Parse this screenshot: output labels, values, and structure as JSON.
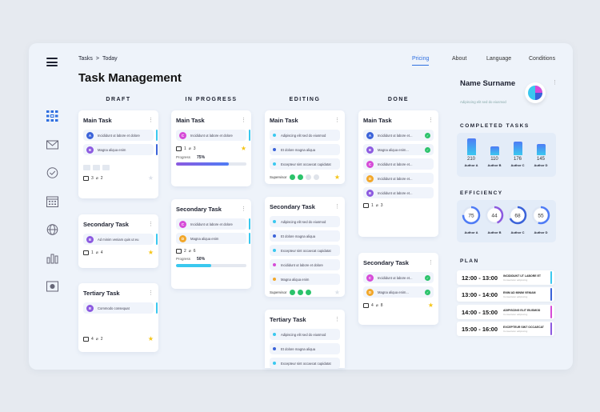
{
  "breadcrumb": {
    "root": "Tasks",
    "sep": ">",
    "current": "Today"
  },
  "title": "Task Management",
  "nav": [
    {
      "label": "Pricing",
      "active": true
    },
    {
      "label": "About"
    },
    {
      "label": "Language"
    },
    {
      "label": "Conditions"
    }
  ],
  "columns": {
    "draft": "DRAFT",
    "progress": "IN PROGRESS",
    "editing": "EDITING",
    "done": "DONE"
  },
  "cards": {
    "d1": {
      "title": "Main Task",
      "items": [
        "Incididunt ut labore et dolore",
        "Magna aliqua enim"
      ],
      "comments": "3",
      "attach": "2"
    },
    "d2": {
      "title": "Secondary Task",
      "items": [
        "Ad minim veniam quis ut eu"
      ],
      "comments": "1",
      "attach": "4"
    },
    "d3": {
      "title": "Tertiary Task",
      "items": [
        "Commodo consequat"
      ],
      "comments": "4",
      "attach": "2"
    },
    "p1": {
      "title": "Main Task",
      "items": [
        "Incididunt ut labore et dolore"
      ],
      "comments": "1",
      "attach": "3",
      "progress_label": "Progress",
      "progress": "75%"
    },
    "p2": {
      "title": "Secondary Task",
      "items": [
        "Incididunt ut labore et dolore",
        "Magna aliqua enim"
      ],
      "comments": "2",
      "attach": "6",
      "progress_label": "Progress",
      "progress": "50%"
    },
    "e1": {
      "title": "Main Task",
      "items": [
        "Adipiscing elit sed do eiusmod",
        "Et dolore magna aliqua",
        "Excepteur sint occaecat cupidatat"
      ],
      "sup": "Supervisor"
    },
    "e2": {
      "title": "Secondary Task",
      "items": [
        "Adipiscing elit sed do eiusmod",
        "Et dolore magna aliqua",
        "Excepteur sint occaecat cupidatat",
        "Incididunt ut labore et dolore",
        "Magna aliqua enim"
      ],
      "sup": "Supervisor"
    },
    "e3": {
      "title": "Tertiary Task",
      "items": [
        "Adipiscing elit sed do eiusmod",
        "Et dolore magna aliqua",
        "Excepteur sint occaecat cupidatat"
      ]
    },
    "n1": {
      "title": "Main Task",
      "items": [
        "Incididunt ut labore et...",
        "Magna aliqua enim...",
        "Incididunt ut labore et...",
        "Incididunt ut labore et...",
        "Incididunt ut labore et..."
      ],
      "comments": "1",
      "attach": "3"
    },
    "n2": {
      "title": "Secondary Task",
      "items": [
        "Incididunt ut labore et...",
        "Magna aliqua enim..."
      ],
      "comments": "4",
      "attach": "8"
    }
  },
  "profile": {
    "name": "Name Surname",
    "sub": "Adipiscing elit sed do eiusmod"
  },
  "completed": {
    "title": "COMPLETED TASKS",
    "authors": [
      {
        "name": "Author A",
        "value": "210"
      },
      {
        "name": "Author B",
        "value": "110"
      },
      {
        "name": "Author C",
        "value": "176"
      },
      {
        "name": "Author D",
        "value": "145"
      }
    ]
  },
  "efficiency": {
    "title": "EFFICIENCY",
    "authors": [
      {
        "name": "Author A",
        "value": "75"
      },
      {
        "name": "Author B",
        "value": "44"
      },
      {
        "name": "Author C",
        "value": "68"
      },
      {
        "name": "Author D",
        "value": "55"
      }
    ]
  },
  "plan": {
    "title": "PLAN",
    "rows": [
      {
        "time": "12:00 - 13:00",
        "ev": "INCIDIDUNT UT LABORE ET",
        "sub": "Consectetur adipiscing"
      },
      {
        "time": "13:00 - 14:00",
        "ev": "ENIM AD MINIM VENIAM",
        "sub": "Consectetur adipiscing"
      },
      {
        "time": "14:00 - 15:00",
        "ev": "ADIPISCING ELIT EIUSMOD",
        "sub": "Consectetur adipiscing"
      },
      {
        "time": "15:00 - 16:00",
        "ev": "EXCEPTEUR SINT OCCAECAT",
        "sub": "Consectetur adipiscing"
      }
    ]
  }
}
